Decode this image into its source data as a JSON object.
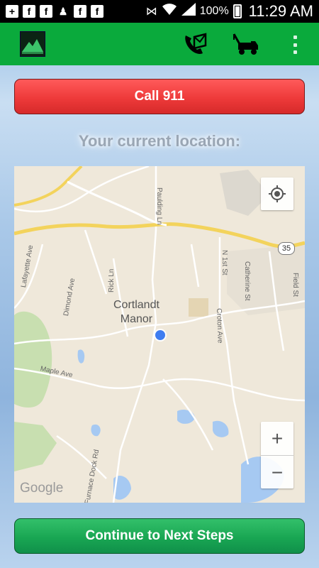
{
  "status_bar": {
    "battery_text": "100%",
    "time": "11:29 AM",
    "left_icons": [
      "plus-icon",
      "facebook-icon",
      "facebook-icon",
      "add-user-icon",
      "facebook-icon",
      "facebook-icon"
    ],
    "right_icons": [
      "mute-icon",
      "wifi-icon",
      "signal-icon",
      "battery-icon"
    ]
  },
  "app_bar": {
    "actions": [
      "phone-icon",
      "tow-truck-icon",
      "overflow-menu-icon"
    ]
  },
  "call_button": {
    "label": "Call 911",
    "color": "#ee3a3a"
  },
  "location_label": "Your current location:",
  "map": {
    "place_name_line1": "Cortlandt",
    "place_name_line2": "Manor",
    "roads": [
      "Paulding Ln",
      "Lafayette Ave",
      "Dimond Ave",
      "Rick Ln",
      "N 1st St",
      "Catherine St",
      "Field St",
      "Croton Ave",
      "Maple Ave",
      "Furnace Dock Rd"
    ],
    "route_shield": "35",
    "attribution": "Google",
    "zoom_in_label": "+",
    "zoom_out_label": "−"
  },
  "next_button": {
    "label": "Continue to Next Steps",
    "color": "#19a653"
  },
  "colors": {
    "app_bar": "#0aaa3c",
    "status_bar": "#000000"
  }
}
